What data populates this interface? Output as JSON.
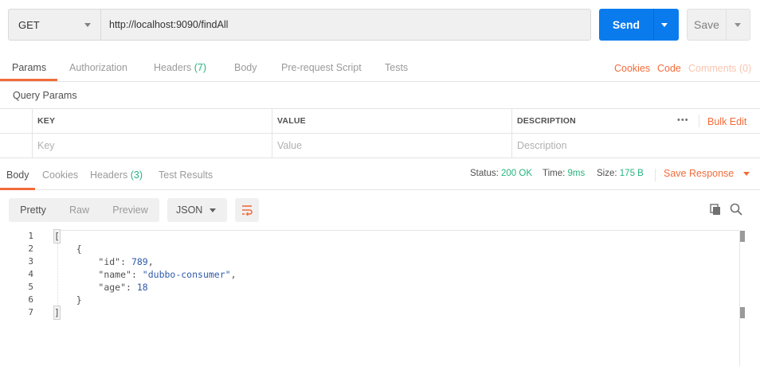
{
  "request": {
    "method": "GET",
    "url": "http://localhost:9090/findAll",
    "send_label": "Send",
    "save_label": "Save"
  },
  "request_tabs": [
    {
      "label": "Params",
      "count": "",
      "active": true
    },
    {
      "label": "Authorization",
      "count": "",
      "active": false
    },
    {
      "label": "Headers",
      "count": "(7)",
      "active": false
    },
    {
      "label": "Body",
      "count": "",
      "active": false
    },
    {
      "label": "Pre-request Script",
      "count": "",
      "active": false
    },
    {
      "label": "Tests",
      "count": "",
      "active": false
    }
  ],
  "request_links": {
    "cookies": "Cookies",
    "code": "Code",
    "comments": "Comments (0)"
  },
  "query_params": {
    "title": "Query Params",
    "headers": {
      "key": "KEY",
      "value": "VALUE",
      "description": "DESCRIPTION"
    },
    "placeholders": {
      "key": "Key",
      "value": "Value",
      "description": "Description"
    },
    "more": "•••",
    "bulk_edit": "Bulk Edit"
  },
  "response_tabs": [
    {
      "label": "Body",
      "count": "",
      "active": true
    },
    {
      "label": "Cookies",
      "count": "",
      "active": false
    },
    {
      "label": "Headers",
      "count": "(3)",
      "active": false
    },
    {
      "label": "Test Results",
      "count": "",
      "active": false
    }
  ],
  "response_status": {
    "status_label": "Status:",
    "status_value": "200 OK",
    "time_label": "Time:",
    "time_value": "9ms",
    "size_label": "Size:",
    "size_value": "175 B",
    "save_response": "Save Response"
  },
  "response_view": {
    "modes": [
      "Pretty",
      "Raw",
      "Preview"
    ],
    "active_mode": "Pretty",
    "format": "JSON"
  },
  "response_body": {
    "line_numbers": [
      "1",
      "2",
      "3",
      "4",
      "5",
      "6",
      "7"
    ],
    "lines": {
      "l1": "[",
      "l2": "    {",
      "l3_key": "\"id\"",
      "l3_val": "789",
      "l4_key": "\"name\"",
      "l4_val": "\"dubbo-consumer\"",
      "l5_key": "\"age\"",
      "l5_val": "18",
      "l6": "    }",
      "l7": "]"
    }
  },
  "colors": {
    "accent": "#f26b3a",
    "send": "#097bed",
    "success": "#26b47f"
  },
  "icons": {
    "copy": "copy-icon",
    "search": "search-icon",
    "wrap": "wrap-lines-icon"
  }
}
